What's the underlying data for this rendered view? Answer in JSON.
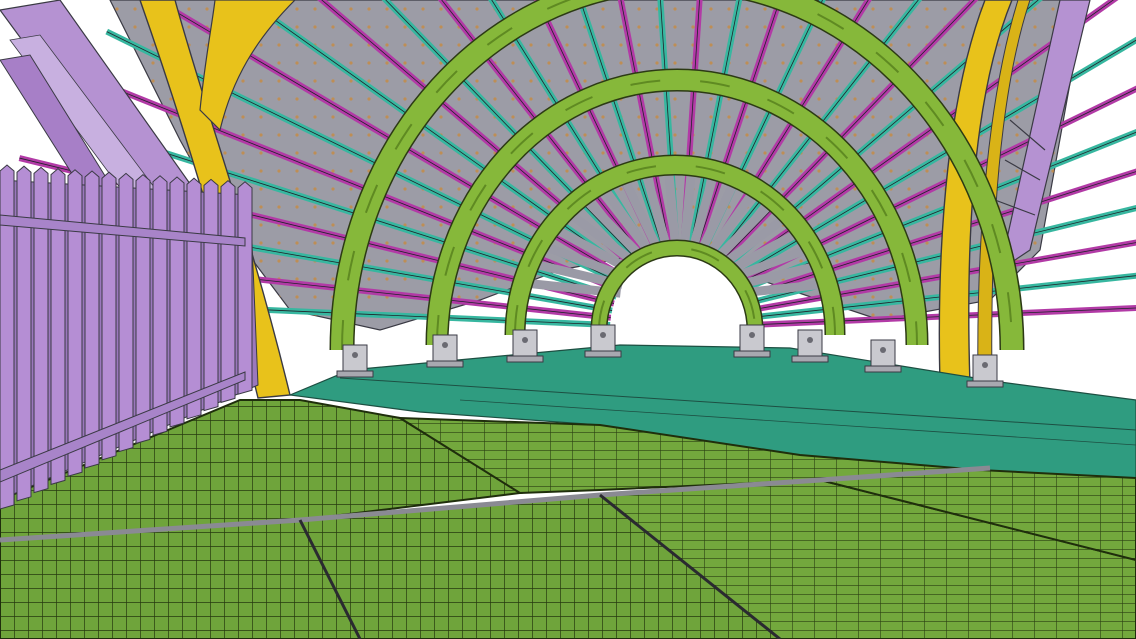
{
  "scene": {
    "colors": {
      "background": "#ffffff",
      "panel": "#9a9aa3",
      "panel_light": "#b8b8c2",
      "rib_teal": "#37b7a0",
      "rib_magenta": "#b23aa6",
      "arch_green": "#86b83a",
      "arch_green_dark": "#5f8a22",
      "column_yellow": "#e7c21c",
      "truss_lilac": "#b592d2",
      "fence_lilac": "#b58ed4",
      "deck_teal": "#2f9c80",
      "grating_green": "#6ea33a",
      "grating_line": "#2a3d12",
      "bolt_orange": "#c98a3a",
      "base_grey": "#c9c9cf"
    }
  }
}
